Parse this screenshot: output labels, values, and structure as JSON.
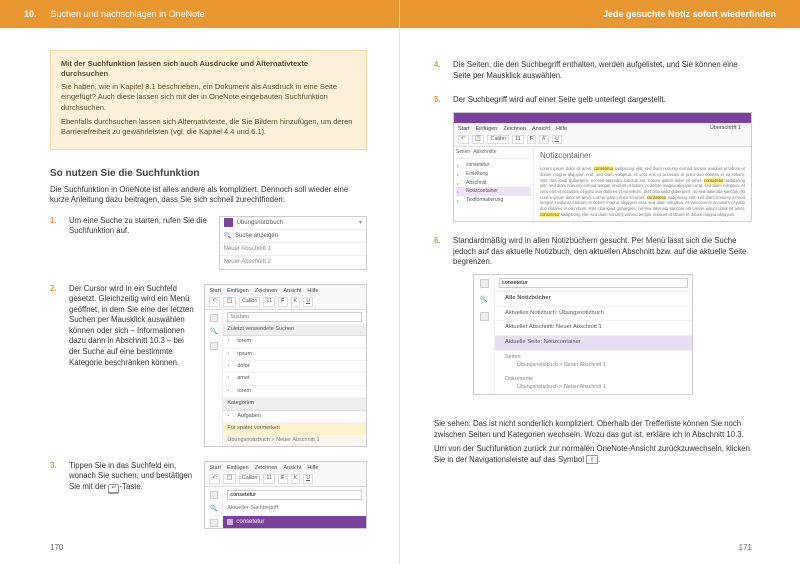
{
  "header": {
    "chapter_num": "10.",
    "chapter_title": "Suchen und nachschlagen in OneNote",
    "right_title": "Jede gesuchte Notiz sofort wiederfinden"
  },
  "tip": {
    "title": "Mit der Suchfunktion lassen sich auch Ausdrucke und Alternativtexte durchsuchen",
    "p1": "Sie haben, wie in Kapitel 8.1 beschrieben, ein Dokument als Ausdruck in eine Seite eingefügt? Auch diese lassen sich mit der in OneNote eingebauten Suchfunktion durchsuchen.",
    "p2": "Ebenfalls durchsuchen lassen sich Alternativtexte, die Sie Bildern hinzufügen, um deren Barrierefreiheit zu gewährleisten (vgl. die Kapitel 4.4 und 6.1)."
  },
  "section_heading": "So nutzen Sie die Suchfunktion",
  "intro": "Die Suchfunktion in OneNote ist alles andere als kompliziert. Dennoch soll wieder eine kurze Anleitung dazu beitragen, dass Sie sich schnell zurechtfinden:",
  "steps": {
    "s1": {
      "n": "1.",
      "text": "Um eine Suche zu starten, rufen Sie die Suchfunktion auf."
    },
    "s2": {
      "n": "2.",
      "text": "Der Cursor wird in ein Suchfeld gesetzt. Gleichzeitig wird ein Menü geöffnet, in dem Sie eine der letzten Suchen per Mausklick auswählen können oder sich – Informationen dazu dann in Abschnitt 10.3 – bei der Suche auf eine bestimmte Kategorie beschränken können."
    },
    "s3": {
      "n": "3.",
      "text_a": "Tippen Sie in das Suchfeld ein, wonach Sie suchen, und bestätigen Sie mit der ",
      "key": "↵",
      "text_b": "-Taste."
    },
    "s4": {
      "n": "4.",
      "text": "Die Seiten, die den Suchbegriff enthalten, werden aufgelistet, und Sie können eine Seite per Mausklick auswählen."
    },
    "s5": {
      "n": "5.",
      "text": "Der Suchbegriff wird auf einer Seite gelb unterlegt dargestellt."
    },
    "s6": {
      "n": "6.",
      "text": "Standardmäßig wird in allen Notizbüchern gesucht. Per Menü lässt sich die Suche jedoch auf das aktuelle Notizbuch, den aktuellen Abschnitt bzw. auf die aktuelle Seite begrenzen."
    }
  },
  "shot1": {
    "notebook": "Übungsnotizbuch",
    "search_line": "Suche anzeigen",
    "sec1": "Neuer Abschnitt 1",
    "sec2": "Neuer Abschnitt 2"
  },
  "ribbon": {
    "t1": "Start",
    "t2": "Einfügen",
    "t3": "Zeichnen",
    "t4": "Ansicht",
    "t5": "Hilfe",
    "font": "Calibri",
    "size": "11",
    "b": "F",
    "i": "K",
    "u": "U"
  },
  "shot2": {
    "input_ph": "Suchen",
    "head": "Zuletzt verwendete Suchen",
    "i1": "lorem",
    "i2": "ipsum",
    "i3": "dolor",
    "i4": "amet",
    "i5": "lorem",
    "cat": "Kategorien",
    "opt1": "Aufgaben",
    "opt2": "Für später vormerken",
    "foot": "Übungsnotizbuch > Neuer Abschnitt 1"
  },
  "shot3": {
    "input_val": "consetetur",
    "reshead": "Aktueller Suchbegriff",
    "result": "consetetur"
  },
  "shot4": {
    "nbtab1": "Seiten",
    "nbtab2": "Abschnitte",
    "nav1": "consetetur",
    "nav2": "Einleitung",
    "nav3": "Abschnitt",
    "nav4": "Notizcontainer",
    "nav5": "Textformatierung",
    "title": "Notizcontainer",
    "hl": "consetetur",
    "title_tab": "Überschrift 1"
  },
  "shot5": {
    "input_val": "consetetur",
    "i1": "Alle Notizbücher",
    "i2": "Aktuelles Notizbuch: Übungsnotizbuch",
    "i3": "Aktueller Abschnitt: Neuer Abschnitt 1",
    "i4": "Aktuelle Seite: Notizcontainer",
    "g1": "Seiten",
    "g1a": "Übungsnotizbuch > Neuer Abschnitt 1",
    "g2": "Dokumente",
    "g2a": "Übungsnotizbuch > Neuer Abschnitt 1"
  },
  "closing": {
    "p1": "Sie sehen: Das ist nicht sonderlich kompliziert. Oberhalb der Trefferliste können Sie noch zwischen Seiten und Kategorien wechseln. Wozu das gut ist, erkläre ich in Abschnitt 10.3.",
    "p2a": "Um von der Suchfunktion zurück zur normalen OneNote-Ansicht zurückzuwechseln, klicken Sie in der Navigationsleiste auf das Symbol ",
    "icon": "▯",
    "p2b": "."
  },
  "pagenums": {
    "left": "170",
    "right": "171"
  }
}
